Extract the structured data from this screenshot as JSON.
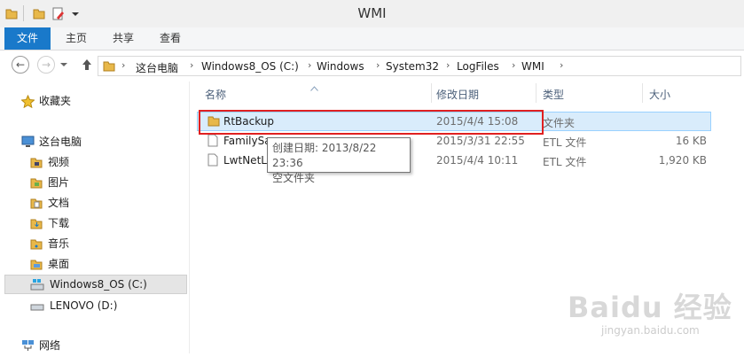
{
  "window": {
    "title": "WMI"
  },
  "ribbon": {
    "tabs": [
      {
        "label": "文件"
      },
      {
        "label": "主页"
      },
      {
        "label": "共享"
      },
      {
        "label": "查看"
      }
    ]
  },
  "address": {
    "crumbs": [
      "这台电脑",
      "Windows8_OS (C:)",
      "Windows",
      "System32",
      "LogFiles",
      "WMI"
    ]
  },
  "nav": {
    "favorites": "收藏夹",
    "this_pc": "这台电脑",
    "items": [
      "视频",
      "图片",
      "文档",
      "下载",
      "音乐",
      "桌面"
    ],
    "drives": [
      "Windows8_OS (C:)",
      "LENOVO (D:)"
    ],
    "network": "网络"
  },
  "columns": {
    "name": "名称",
    "date": "修改日期",
    "type": "类型",
    "size": "大小"
  },
  "files": [
    {
      "name": "RtBackup",
      "date": "2015/4/4 15:08",
      "type": "文件夹",
      "size": ""
    },
    {
      "name": "FamilySa",
      "date": "2015/3/31 22:55",
      "type": "ETL 文件",
      "size": "16 KB"
    },
    {
      "name": "LwtNetLo",
      "date": "2015/4/4 10:11",
      "type": "ETL 文件",
      "size": "1,920 KB"
    }
  ],
  "tooltip": {
    "line1": "创建日期: 2013/8/22 23:36",
    "line2": "空文件夹"
  },
  "watermark": {
    "brand": "Baidu 经验",
    "url": "jingyan.baidu.com"
  },
  "colors": {
    "accent": "#1979ca",
    "highlight": "#e02020",
    "selection": "#d9ecfb",
    "folder": "#e8b84a"
  }
}
